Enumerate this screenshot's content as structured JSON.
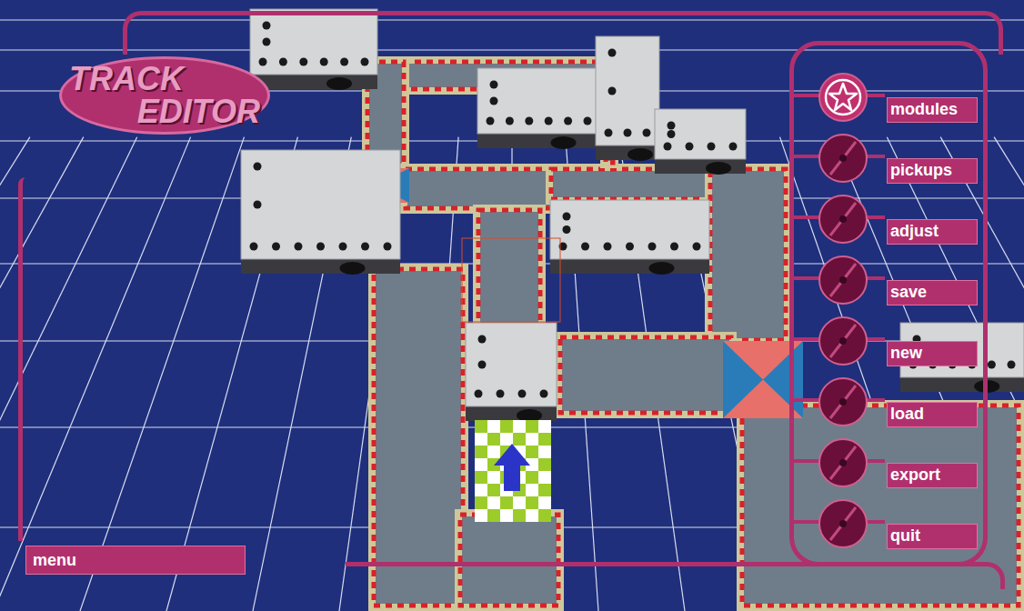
{
  "logo": {
    "line1": "TRACK",
    "line2": "EDITOR"
  },
  "menu_items": [
    {
      "label": "modules",
      "selected": true
    },
    {
      "label": "pickups",
      "selected": false
    },
    {
      "label": "adjust",
      "selected": false
    },
    {
      "label": "save",
      "selected": false
    },
    {
      "label": "new",
      "selected": false
    },
    {
      "label": "load",
      "selected": false
    },
    {
      "label": "export",
      "selected": false
    },
    {
      "label": "quit",
      "selected": false
    }
  ],
  "menu_bar": {
    "label": "menu"
  }
}
